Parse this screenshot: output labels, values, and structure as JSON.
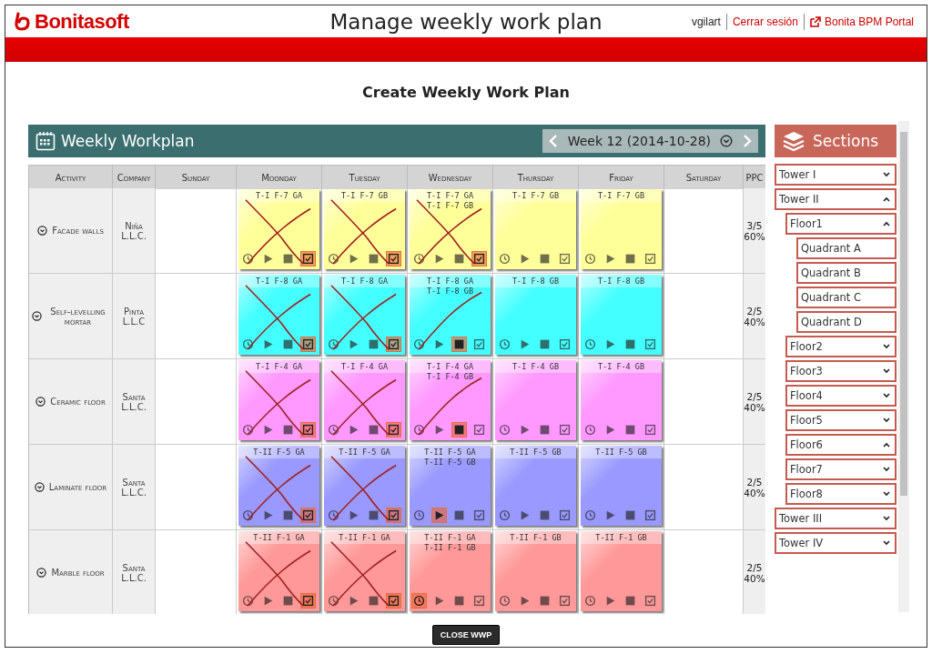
{
  "header": {
    "logo": "Bonitasoft",
    "title": "Manage weekly work plan",
    "user": "vgilart",
    "logout": "Cerrar sesión",
    "portal_link": "Bonita BPM Portal"
  },
  "page_title": "Create Weekly Work Plan",
  "workplan": {
    "title": "Weekly Workplan",
    "week": "Week 12 (2014-10-28)",
    "columns": [
      "Activity",
      "Company",
      "Sunday",
      "Moonday",
      "Tuesday",
      "Wednesday",
      "Thursday",
      "Friday",
      "Saturday",
      "PPC"
    ],
    "rows": [
      {
        "activity": "Facade walls",
        "company": "Niña L.L.C.",
        "color": "#ffff99",
        "ppc_ratio": "3/5",
        "ppc_percent": "60%",
        "days": [
          {
            "kind": "empty"
          },
          {
            "kind": "note",
            "labels": [
              "T-I F-7 GA"
            ],
            "crossed_out": true,
            "slashed": false,
            "tools": [
              {
                "kind": "clock",
                "selected": false
              },
              {
                "kind": "play",
                "selected": false
              },
              {
                "kind": "stop",
                "selected": false
              },
              {
                "kind": "check",
                "selected": true
              }
            ]
          },
          {
            "kind": "note",
            "labels": [
              "T-I F-7 GB"
            ],
            "crossed_out": true,
            "slashed": false,
            "tools": [
              {
                "kind": "clock",
                "selected": false
              },
              {
                "kind": "play",
                "selected": false
              },
              {
                "kind": "stop",
                "selected": false
              },
              {
                "kind": "check",
                "selected": true
              }
            ]
          },
          {
            "kind": "note",
            "labels": [
              "T-I F-7 GA",
              "T-I F-7 GB"
            ],
            "crossed_out": true,
            "slashed": false,
            "tools": [
              {
                "kind": "clock",
                "selected": false
              },
              {
                "kind": "play",
                "selected": false
              },
              {
                "kind": "stop",
                "selected": false
              },
              {
                "kind": "check",
                "selected": true
              }
            ]
          },
          {
            "kind": "note",
            "labels": [
              "T-I F-7 GB"
            ],
            "crossed_out": false,
            "slashed": false,
            "tools": [
              {
                "kind": "clock",
                "selected": false
              },
              {
                "kind": "play",
                "selected": false
              },
              {
                "kind": "stop",
                "selected": false
              },
              {
                "kind": "check",
                "selected": false
              }
            ]
          },
          {
            "kind": "note",
            "labels": [
              "T-I F-7 GB"
            ],
            "crossed_out": false,
            "slashed": false,
            "tools": [
              {
                "kind": "clock",
                "selected": false
              },
              {
                "kind": "play",
                "selected": false
              },
              {
                "kind": "stop",
                "selected": false
              },
              {
                "kind": "check",
                "selected": false
              }
            ]
          },
          {
            "kind": "empty"
          }
        ]
      },
      {
        "activity": "Self-levelling mortar",
        "company": "Pinta L.L.C",
        "color": "#44ffff",
        "ppc_ratio": "2/5",
        "ppc_percent": "40%",
        "days": [
          {
            "kind": "empty"
          },
          {
            "kind": "note",
            "labels": [
              "T-I F-8 GA"
            ],
            "crossed_out": true,
            "slashed": false,
            "tools": [
              {
                "kind": "clock",
                "selected": false
              },
              {
                "kind": "play",
                "selected": false
              },
              {
                "kind": "stop",
                "selected": false
              },
              {
                "kind": "check",
                "selected": true
              }
            ]
          },
          {
            "kind": "note",
            "labels": [
              "T-I F-8 GA"
            ],
            "crossed_out": true,
            "slashed": false,
            "tools": [
              {
                "kind": "clock",
                "selected": false
              },
              {
                "kind": "play",
                "selected": false
              },
              {
                "kind": "stop",
                "selected": false
              },
              {
                "kind": "check",
                "selected": true
              }
            ]
          },
          {
            "kind": "note",
            "labels": [
              "T-I F-8 GA",
              "T-I F-8 GB"
            ],
            "crossed_out": false,
            "slashed": true,
            "tools": [
              {
                "kind": "clock",
                "selected": false
              },
              {
                "kind": "play",
                "selected": false
              },
              {
                "kind": "stop",
                "selected": true
              },
              {
                "kind": "check",
                "selected": false
              }
            ]
          },
          {
            "kind": "note",
            "labels": [
              "T-I F-8 GB"
            ],
            "crossed_out": false,
            "slashed": false,
            "tools": [
              {
                "kind": "clock",
                "selected": false
              },
              {
                "kind": "play",
                "selected": false
              },
              {
                "kind": "stop",
                "selected": false
              },
              {
                "kind": "check",
                "selected": false
              }
            ]
          },
          {
            "kind": "note",
            "labels": [
              "T-I F-8 GB"
            ],
            "crossed_out": false,
            "slashed": false,
            "tools": [
              {
                "kind": "clock",
                "selected": false
              },
              {
                "kind": "play",
                "selected": false
              },
              {
                "kind": "stop",
                "selected": false
              },
              {
                "kind": "check",
                "selected": false
              }
            ]
          },
          {
            "kind": "empty"
          }
        ]
      },
      {
        "activity": "Ceramic floor",
        "company": "Santa L.L.C.",
        "color": "#ff99ff",
        "ppc_ratio": "2/5",
        "ppc_percent": "40%",
        "days": [
          {
            "kind": "empty"
          },
          {
            "kind": "note",
            "labels": [
              "T-I F-4 GA"
            ],
            "crossed_out": true,
            "slashed": false,
            "tools": [
              {
                "kind": "clock",
                "selected": false
              },
              {
                "kind": "play",
                "selected": false
              },
              {
                "kind": "stop",
                "selected": false
              },
              {
                "kind": "check",
                "selected": true
              }
            ]
          },
          {
            "kind": "note",
            "labels": [
              "T-I F-4 GA"
            ],
            "crossed_out": true,
            "slashed": false,
            "tools": [
              {
                "kind": "clock",
                "selected": false
              },
              {
                "kind": "play",
                "selected": false
              },
              {
                "kind": "stop",
                "selected": false
              },
              {
                "kind": "check",
                "selected": true
              }
            ]
          },
          {
            "kind": "note",
            "labels": [
              "T-I F-4 GA",
              "T-I F-4 GB"
            ],
            "crossed_out": false,
            "slashed": true,
            "tools": [
              {
                "kind": "clock",
                "selected": false
              },
              {
                "kind": "play",
                "selected": false
              },
              {
                "kind": "stop",
                "selected": true
              },
              {
                "kind": "check",
                "selected": false
              }
            ]
          },
          {
            "kind": "note",
            "labels": [
              "T-I F-4 GB"
            ],
            "crossed_out": false,
            "slashed": false,
            "tools": [
              {
                "kind": "clock",
                "selected": false
              },
              {
                "kind": "play",
                "selected": false
              },
              {
                "kind": "stop",
                "selected": false
              },
              {
                "kind": "check",
                "selected": false
              }
            ]
          },
          {
            "kind": "note",
            "labels": [
              "T-I F-4 GB"
            ],
            "crossed_out": false,
            "slashed": false,
            "tools": [
              {
                "kind": "clock",
                "selected": false
              },
              {
                "kind": "play",
                "selected": false
              },
              {
                "kind": "stop",
                "selected": false
              },
              {
                "kind": "check",
                "selected": false
              }
            ]
          },
          {
            "kind": "empty"
          }
        ]
      },
      {
        "activity": "Laminate floor",
        "company": "Santa L.L.C.",
        "color": "#9999ff",
        "ppc_ratio": "2/5",
        "ppc_percent": "40%",
        "days": [
          {
            "kind": "empty"
          },
          {
            "kind": "note",
            "labels": [
              "T-II F-5 GA"
            ],
            "crossed_out": true,
            "slashed": false,
            "tools": [
              {
                "kind": "clock",
                "selected": false
              },
              {
                "kind": "play",
                "selected": false
              },
              {
                "kind": "stop",
                "selected": false
              },
              {
                "kind": "check",
                "selected": true
              }
            ]
          },
          {
            "kind": "note",
            "labels": [
              "T-II F-5 GA"
            ],
            "crossed_out": true,
            "slashed": false,
            "tools": [
              {
                "kind": "clock",
                "selected": false
              },
              {
                "kind": "play",
                "selected": false
              },
              {
                "kind": "stop",
                "selected": false
              },
              {
                "kind": "check",
                "selected": true
              }
            ]
          },
          {
            "kind": "note",
            "labels": [
              "T-II F-5 GA",
              "T-II F-5 GB"
            ],
            "crossed_out": false,
            "slashed": false,
            "tools": [
              {
                "kind": "clock",
                "selected": false
              },
              {
                "kind": "play",
                "selected": true
              },
              {
                "kind": "stop",
                "selected": false
              },
              {
                "kind": "check",
                "selected": false
              }
            ]
          },
          {
            "kind": "note",
            "labels": [
              "T-II F-5 GB"
            ],
            "crossed_out": false,
            "slashed": false,
            "tools": [
              {
                "kind": "clock",
                "selected": false
              },
              {
                "kind": "play",
                "selected": false
              },
              {
                "kind": "stop",
                "selected": false
              },
              {
                "kind": "check",
                "selected": false
              }
            ]
          },
          {
            "kind": "note",
            "labels": [
              "T-II F-5 GB"
            ],
            "crossed_out": false,
            "slashed": false,
            "tools": [
              {
                "kind": "clock",
                "selected": false
              },
              {
                "kind": "play",
                "selected": false
              },
              {
                "kind": "stop",
                "selected": false
              },
              {
                "kind": "check",
                "selected": false
              }
            ]
          },
          {
            "kind": "empty"
          }
        ]
      },
      {
        "activity": "Marble floor",
        "company": "Santa L.L.C.",
        "color": "#ff9999",
        "ppc_ratio": "2/5",
        "ppc_percent": "40%",
        "days": [
          {
            "kind": "empty"
          },
          {
            "kind": "note",
            "labels": [
              "T-II F-1 GA"
            ],
            "crossed_out": true,
            "slashed": false,
            "tools": [
              {
                "kind": "clock",
                "selected": false
              },
              {
                "kind": "play",
                "selected": false
              },
              {
                "kind": "stop",
                "selected": false
              },
              {
                "kind": "check",
                "selected": true
              }
            ]
          },
          {
            "kind": "note",
            "labels": [
              "T-II F-1 GA"
            ],
            "crossed_out": true,
            "slashed": false,
            "tools": [
              {
                "kind": "clock",
                "selected": false
              },
              {
                "kind": "play",
                "selected": false
              },
              {
                "kind": "stop",
                "selected": false
              },
              {
                "kind": "check",
                "selected": true
              }
            ]
          },
          {
            "kind": "note",
            "labels": [
              "T-II F-1 GA",
              "T-II F-1 GB"
            ],
            "crossed_out": false,
            "slashed": false,
            "tools": [
              {
                "kind": "clock",
                "selected": true
              },
              {
                "kind": "play",
                "selected": false
              },
              {
                "kind": "stop",
                "selected": false
              },
              {
                "kind": "check",
                "selected": false
              }
            ]
          },
          {
            "kind": "note",
            "labels": [
              "T-II F-1 GB"
            ],
            "crossed_out": false,
            "slashed": false,
            "tools": [
              {
                "kind": "clock",
                "selected": false
              },
              {
                "kind": "play",
                "selected": false
              },
              {
                "kind": "stop",
                "selected": false
              },
              {
                "kind": "check",
                "selected": false
              }
            ]
          },
          {
            "kind": "note",
            "labels": [
              "T-II F-1 GB"
            ],
            "crossed_out": false,
            "slashed": false,
            "tools": [
              {
                "kind": "clock",
                "selected": false
              },
              {
                "kind": "play",
                "selected": false
              },
              {
                "kind": "stop",
                "selected": false
              },
              {
                "kind": "check",
                "selected": false
              }
            ]
          },
          {
            "kind": "empty"
          }
        ]
      }
    ]
  },
  "sections": {
    "title": "Sections",
    "items": [
      {
        "label": "Tower I",
        "expanded": false
      },
      {
        "label": "Tower II",
        "expanded": true,
        "children": [
          {
            "label": "Floor1",
            "expanded": true,
            "children": [
              {
                "label": "Quadrant A"
              },
              {
                "label": "Quadrant B"
              },
              {
                "label": "Quadrant C"
              },
              {
                "label": "Quadrant D"
              }
            ]
          },
          {
            "label": "Floor2",
            "expanded": false
          },
          {
            "label": "Floor3",
            "expanded": false
          },
          {
            "label": "Floor4",
            "expanded": false
          },
          {
            "label": "Floor5",
            "expanded": false
          },
          {
            "label": "Floor6",
            "expanded": true
          },
          {
            "label": "Floor7",
            "expanded": false
          },
          {
            "label": "Floor8",
            "expanded": false
          }
        ]
      },
      {
        "label": "Tower III",
        "expanded": false
      },
      {
        "label": "Tower IV",
        "expanded": false
      }
    ]
  },
  "close_button": "CLOSE WWP"
}
